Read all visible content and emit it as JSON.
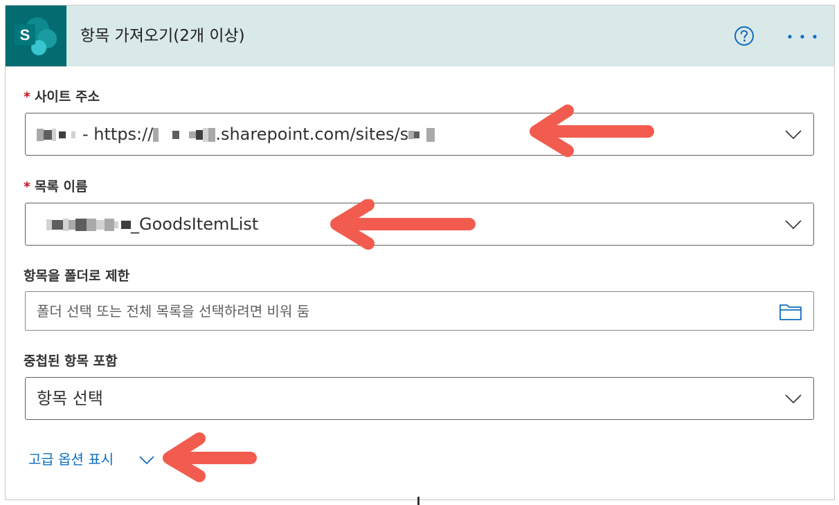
{
  "header": {
    "title": "항목 가져오기(2개 이상)",
    "app_icon": "sharepoint-logo-icon",
    "app_letter": "S",
    "help_icon": "help-circle-icon",
    "more_icon": "more-dots-icon",
    "accent_color": "#036c70",
    "header_bg": "#d9e8e8"
  },
  "fields": {
    "site": {
      "label": "사이트 주소",
      "required_mark": "*",
      "value_prefix": "- https://",
      "value_mid": ".sharepoint.com/sites/s",
      "dropdown_icon": "chevron-down-icon"
    },
    "list": {
      "label": "목록 이름",
      "required_mark": "*",
      "value_suffix": "_GoodsItemList",
      "dropdown_icon": "chevron-down-icon"
    },
    "folder": {
      "label": "항목을 폴더로 제한",
      "placeholder": "폴더 선택 또는 전체 목록을 선택하려면 비워 둠",
      "icon": "folder-icon"
    },
    "nested": {
      "label": "중첩된 항목 포함",
      "value": "항목 선택",
      "dropdown_icon": "chevron-down-icon"
    }
  },
  "advanced": {
    "label": "고급 옵션 표시",
    "link_color": "#0f6cbd"
  },
  "annotations": {
    "arrow_color": "#f25c4f"
  }
}
